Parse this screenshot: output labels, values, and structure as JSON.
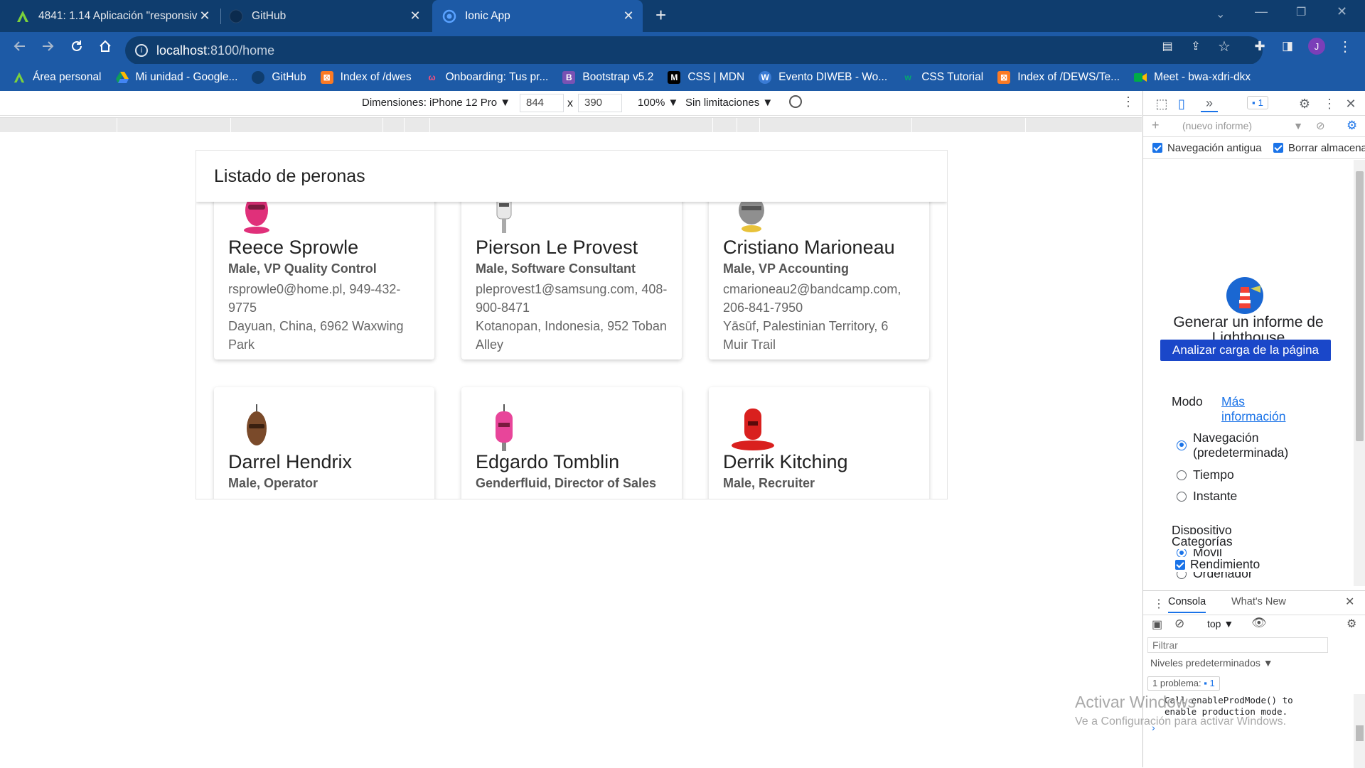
{
  "tabs": [
    {
      "title": "4841: 1.14 Aplicación \"responsive",
      "favicon": "A"
    },
    {
      "title": "GitHub",
      "favicon": "github"
    },
    {
      "title": "Ionic App",
      "favicon": "ionic"
    }
  ],
  "address": {
    "host": "localhost",
    "path": ":8100/home"
  },
  "bookmarks": [
    {
      "label": "Área personal",
      "icon": "A"
    },
    {
      "label": "Mi unidad - Google...",
      "icon": "drive"
    },
    {
      "label": "GitHub",
      "icon": "github"
    },
    {
      "label": "Index of /dwes",
      "icon": "xampp"
    },
    {
      "label": "Onboarding: Tus pr...",
      "icon": "onboarding"
    },
    {
      "label": "Bootstrap v5.2",
      "icon": "B"
    },
    {
      "label": "CSS | MDN",
      "icon": "M"
    },
    {
      "label": "Evento DIWEB - Wo...",
      "icon": "W"
    },
    {
      "label": "CSS Tutorial",
      "icon": "w3"
    },
    {
      "label": "Index of /DEWS/Te...",
      "icon": "xampp"
    },
    {
      "label": "Meet - bwa-xdri-dkx",
      "icon": "meet"
    }
  ],
  "device_toolbar": {
    "dimensions_label": "Dimensiones: iPhone 12 Pro",
    "width": "844",
    "times": "x",
    "height": "390",
    "zoom": "100%",
    "throttle": "Sin limitaciones"
  },
  "app": {
    "header_title": "Listado de peronas",
    "people": [
      {
        "name": "Reece Sprowle",
        "role": "Male, VP Quality Control",
        "contact": "rsprowle0@home.pl, 949-432-9775",
        "address": "Dayuan, China, 6962 Waxwing Park",
        "robot_color": "#e0307a"
      },
      {
        "name": "Pierson Le Provest",
        "role": "Male, Software Consultant",
        "contact": "pleprovest1@samsung.com, 408-900-8471",
        "address": "Kotanopan, Indonesia, 952 Toban Alley",
        "robot_color": "#d9d9d9"
      },
      {
        "name": "Cristiano Marioneau",
        "role": "Male, VP Accounting",
        "contact": "cmarioneau2@bandcamp.com, 206-841-7950",
        "address": "Yāsūf, Palestinian Territory, 6 Muir Trail",
        "robot_color": "#8f8f8f"
      },
      {
        "name": "Darrel Hendrix",
        "role": "Male, Operator",
        "robot_color": "#7a4a2a"
      },
      {
        "name": "Edgardo Tomblin",
        "role": "Genderfluid, Director of Sales",
        "robot_color": "#e8459a"
      },
      {
        "name": "Derrik Kitching",
        "role": "Male, Recruiter",
        "robot_color": "#d9201e"
      }
    ]
  },
  "devtools": {
    "issues_count": "1",
    "report_select": "(nuevo informe)",
    "check_legacy": "Navegación antigua",
    "check_clear": "Borrar almacenam",
    "lighthouse_title": "Generar un informe de Lighthouse",
    "analyze_button": "Analizar carga de la página",
    "mode_label": "Modo",
    "more_info": "Más información",
    "modes": [
      "Navegación (predeterminada)",
      "Tiempo",
      "Instante"
    ],
    "device_label": "Dispositivo",
    "devices": [
      "Móvil",
      "Ordenador"
    ],
    "categories_label": "Categorías",
    "category_performance": "Rendimiento",
    "drawer_tabs": [
      "Consola",
      "What's New"
    ],
    "context": "top",
    "filter_placeholder": "Filtrar",
    "levels": "Niveles predeterminados",
    "problems_label": "1 problema:",
    "problems_count": "1",
    "console_line1": "Call enableProdMode() to",
    "console_line2": "enable production mode."
  },
  "watermark": {
    "title": "Activar Windows",
    "subtitle": "Ve a Configuración para activar Windows."
  }
}
